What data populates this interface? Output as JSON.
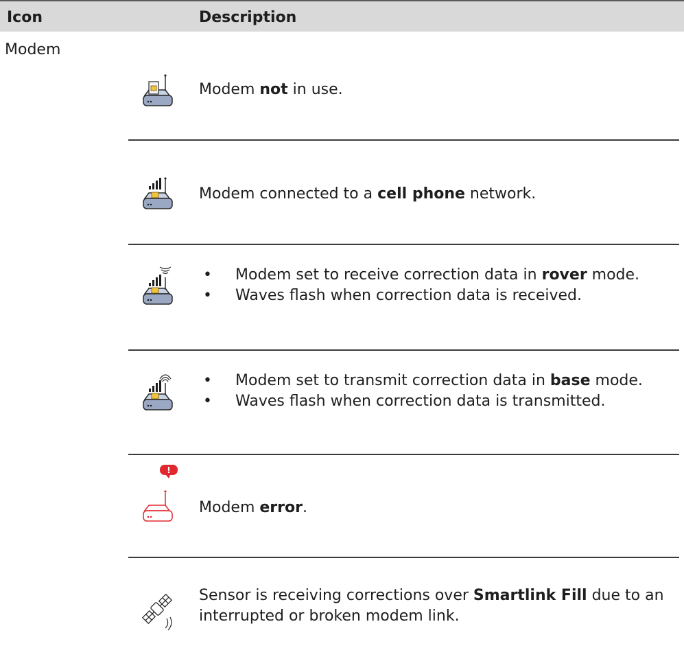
{
  "header": {
    "icon_label": "Icon",
    "description_label": "Description"
  },
  "section": {
    "title": "Modem"
  },
  "rows": [
    {
      "icon": "modem-not-in-use-icon",
      "parts": [
        {
          "t": "Modem "
        },
        {
          "t": "not",
          "b": true
        },
        {
          "t": " in use."
        }
      ]
    },
    {
      "icon": "modem-cell-network-icon",
      "parts": [
        {
          "t": "Modem connected to a "
        },
        {
          "t": "cell phone",
          "b": true
        },
        {
          "t": " network."
        }
      ]
    },
    {
      "icon": "modem-rover-receive-icon",
      "bullets": [
        [
          {
            "t": "Modem set to receive correction data in "
          },
          {
            "t": "rover",
            "b": true
          },
          {
            "t": " mode."
          }
        ],
        [
          {
            "t": "Waves flash when correction data is received."
          }
        ]
      ]
    },
    {
      "icon": "modem-base-transmit-icon",
      "bullets": [
        [
          {
            "t": "Modem set to transmit correction data in "
          },
          {
            "t": "base",
            "b": true
          },
          {
            "t": " mode."
          }
        ],
        [
          {
            "t": "Waves flash when correction data is transmitted."
          }
        ]
      ]
    },
    {
      "icon": "modem-error-icon",
      "parts": [
        {
          "t": "Modem "
        },
        {
          "t": "error",
          "b": true
        },
        {
          "t": "."
        }
      ]
    },
    {
      "icon": "smartlink-fill-satellite-icon",
      "parts": [
        {
          "t": "Sensor is receiving corrections over "
        },
        {
          "t": "Smartlink Fill",
          "b": true
        },
        {
          "t": " due to an interrupted or broken modem link."
        }
      ]
    }
  ],
  "colors": {
    "header_bg": "#d9d9d9",
    "error_red": "#e0282e",
    "modem_body": "#9aa8c4"
  }
}
